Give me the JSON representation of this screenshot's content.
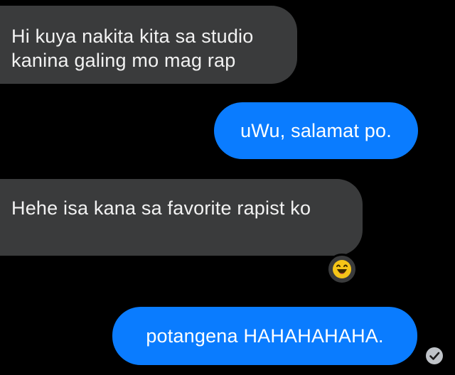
{
  "conversation": {
    "messages": [
      {
        "direction": "incoming",
        "text": "Hi kuya nakita kita sa studio kanina galing mo mag rap"
      },
      {
        "direction": "outgoing",
        "text": "uWu, salamat po."
      },
      {
        "direction": "incoming",
        "text": "Hehe isa kana sa favorite rapist ko",
        "reaction": "laughing-emoji"
      },
      {
        "direction": "outgoing",
        "text": "potangena HAHAHAHAHA.",
        "status_icon": "read-check-icon"
      }
    ]
  },
  "colors": {
    "background": "#000000",
    "incoming_bubble": "#3a3b3c",
    "outgoing_bubble": "#0a7cff",
    "emoji_face": "#f5c518"
  }
}
